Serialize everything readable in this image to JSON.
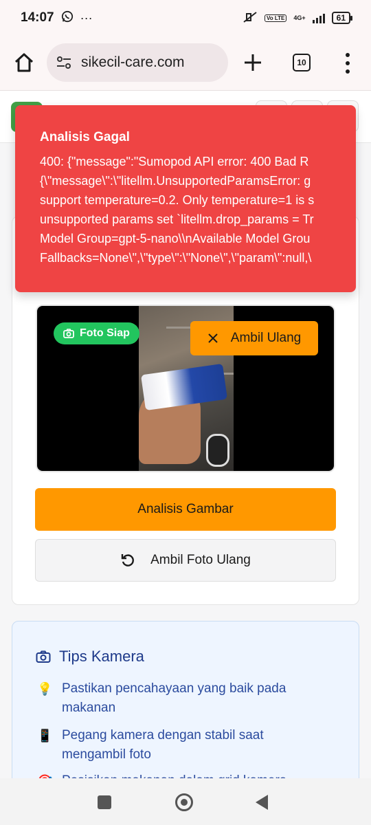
{
  "status_bar": {
    "time": "14:07",
    "more_dots": "···",
    "network": "4G+",
    "lte": "Vo LTE",
    "battery": "61"
  },
  "browser": {
    "url": "sikecil-care.com",
    "tab_count": "10"
  },
  "toast": {
    "title": "Analisis Gagal",
    "lines": [
      "400: {\"message\":\"Sumopod API error: 400 Bad R",
      "{\\\"message\\\":\\\"litellm.UnsupportedParamsError: g",
      "support temperature=0.2. Only temperature=1 is s",
      "unsupported params set `litellm.drop_params = Tr",
      "Model Group=gpt-5-nano\\\\nAvailable Model Grou",
      "Fallbacks=None\\\",\\\"type\\\":\\\"None\\\",\\\"param\\\":null,\\"
    ],
    "color": "#ef4444"
  },
  "camera": {
    "badge": "Foto Siap",
    "retake_small": "Ambil Ulang",
    "analyze": "Analisis Gambar",
    "retake": "Ambil Foto Ulang"
  },
  "tips": {
    "title": "Tips Kamera",
    "items": [
      {
        "icon": "💡",
        "text1": "Pastikan pencahayaan yang baik pada",
        "text2": "makanan"
      },
      {
        "icon": "📱",
        "text1": "Pegang kamera dengan stabil saat",
        "text2": "mengambil foto"
      },
      {
        "icon": "🎯",
        "text1": "Posisikan makanan dalam grid kamera",
        "text2": ""
      }
    ]
  },
  "colors": {
    "accent": "#ff9800",
    "success": "#22c55e",
    "error": "#ef4444",
    "tips_text": "#2b4b9e"
  }
}
